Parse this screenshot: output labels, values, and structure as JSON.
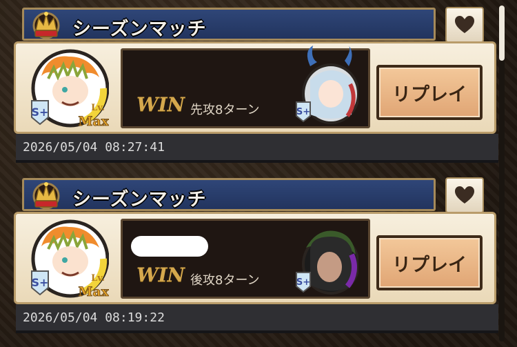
{
  "matches": [
    {
      "title": "シーズンマッチ",
      "result": "WIN",
      "turn_text": "先攻8ターン",
      "replay_label": "リプレイ",
      "datetime": "2026/05/04 08:27:41",
      "player_level": "Max",
      "player_level_prefix": "Lv.",
      "rank_badge": "S+",
      "opponent_name_visible": false
    },
    {
      "title": "シーズンマッチ",
      "result": "WIN",
      "turn_text": "後攻8ターン",
      "replay_label": "リプレイ",
      "datetime": "2026/05/04 08:19:22",
      "player_level": "Max",
      "player_level_prefix": "Lv.",
      "rank_badge": "S+",
      "opponent_name_visible": true
    }
  ],
  "colors": {
    "header_blue": "#2a3d6c",
    "panel_cream": "#f2e6cf",
    "win_gold": "#d5a84d",
    "replay_orange": "#e8b584"
  },
  "icons": {
    "favorite": "heart-icon",
    "crown": "crown-icon"
  }
}
